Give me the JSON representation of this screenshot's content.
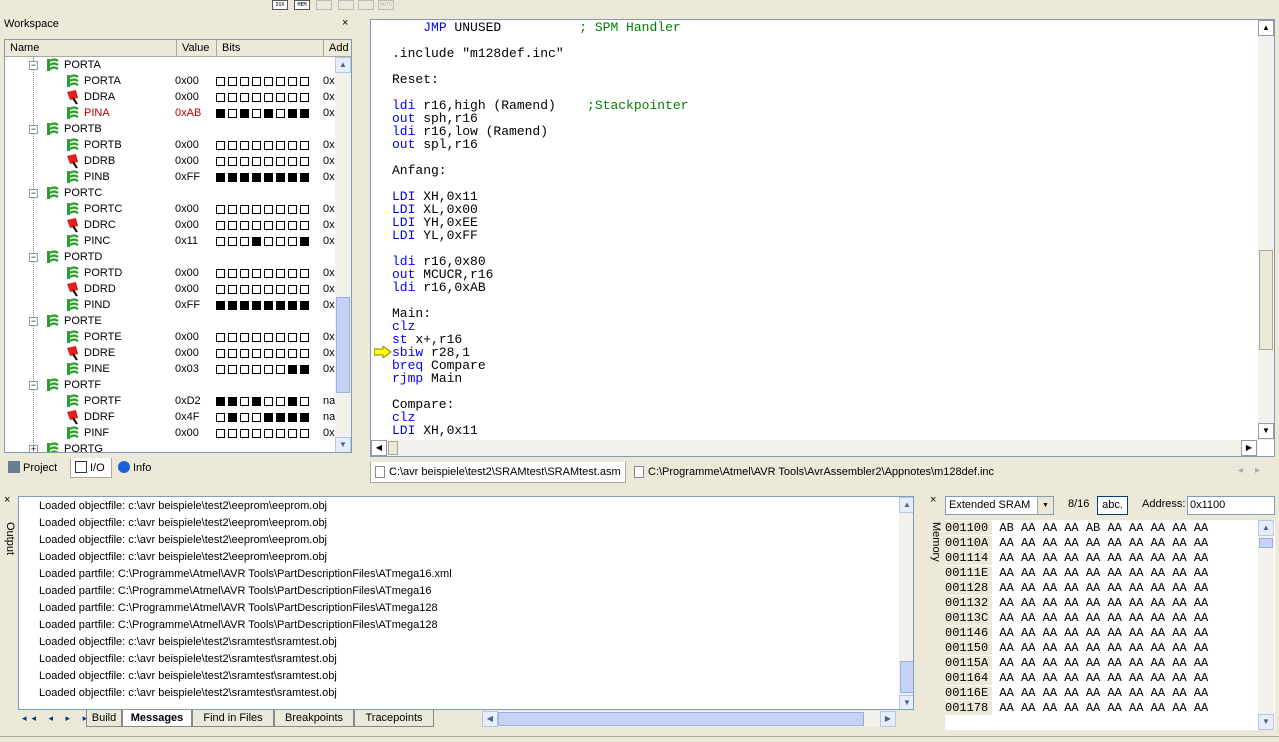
{
  "toolbar": {
    "icons": [
      {
        "name": "io-view-icon",
        "label": "IOX"
      },
      {
        "name": "mem-view-icon",
        "label": "MEM"
      },
      {
        "name": "processor-icon",
        "label": ""
      },
      {
        "name": "watch-icon",
        "label": ""
      },
      {
        "name": "disassembler-icon",
        "label": ""
      },
      {
        "name": "auto-icon",
        "label": "AUTO"
      }
    ]
  },
  "workspace": {
    "title": "Workspace",
    "close": "×",
    "columns": {
      "name": "Name",
      "value": "Value",
      "bits": "Bits",
      "addr": "Add"
    },
    "groups": [
      {
        "name": "PORTA",
        "regs": [
          {
            "name": "PORTA",
            "value": "0x00",
            "bits": [
              0,
              0,
              0,
              0,
              0,
              0,
              0,
              0
            ],
            "addr": "0x",
            "icon": "port",
            "red": false
          },
          {
            "name": "DDRA",
            "value": "0x00",
            "bits": [
              0,
              0,
              0,
              0,
              0,
              0,
              0,
              0
            ],
            "addr": "0x",
            "icon": "ddr",
            "red": false
          },
          {
            "name": "PINA",
            "value": "0xAB",
            "bits": [
              1,
              0,
              1,
              0,
              1,
              0,
              1,
              1
            ],
            "addr": "0x",
            "icon": "pin",
            "red": true
          }
        ]
      },
      {
        "name": "PORTB",
        "regs": [
          {
            "name": "PORTB",
            "value": "0x00",
            "bits": [
              0,
              0,
              0,
              0,
              0,
              0,
              0,
              0
            ],
            "addr": "0x",
            "icon": "port",
            "red": false
          },
          {
            "name": "DDRB",
            "value": "0x00",
            "bits": [
              0,
              0,
              0,
              0,
              0,
              0,
              0,
              0
            ],
            "addr": "0x",
            "icon": "ddr",
            "red": false
          },
          {
            "name": "PINB",
            "value": "0xFF",
            "bits": [
              1,
              1,
              1,
              1,
              1,
              1,
              1,
              1
            ],
            "addr": "0x",
            "icon": "pin",
            "red": false
          }
        ]
      },
      {
        "name": "PORTC",
        "regs": [
          {
            "name": "PORTC",
            "value": "0x00",
            "bits": [
              0,
              0,
              0,
              0,
              0,
              0,
              0,
              0
            ],
            "addr": "0x",
            "icon": "port",
            "red": false
          },
          {
            "name": "DDRC",
            "value": "0x00",
            "bits": [
              0,
              0,
              0,
              0,
              0,
              0,
              0,
              0
            ],
            "addr": "0x",
            "icon": "ddr",
            "red": false
          },
          {
            "name": "PINC",
            "value": "0x11",
            "bits": [
              0,
              0,
              0,
              1,
              0,
              0,
              0,
              1
            ],
            "addr": "0x",
            "icon": "pin",
            "red": false
          }
        ]
      },
      {
        "name": "PORTD",
        "regs": [
          {
            "name": "PORTD",
            "value": "0x00",
            "bits": [
              0,
              0,
              0,
              0,
              0,
              0,
              0,
              0
            ],
            "addr": "0x",
            "icon": "port",
            "red": false
          },
          {
            "name": "DDRD",
            "value": "0x00",
            "bits": [
              0,
              0,
              0,
              0,
              0,
              0,
              0,
              0
            ],
            "addr": "0x",
            "icon": "ddr",
            "red": false
          },
          {
            "name": "PIND",
            "value": "0xFF",
            "bits": [
              1,
              1,
              1,
              1,
              1,
              1,
              1,
              1
            ],
            "addr": "0x",
            "icon": "pin",
            "red": false
          }
        ]
      },
      {
        "name": "PORTE",
        "regs": [
          {
            "name": "PORTE",
            "value": "0x00",
            "bits": [
              0,
              0,
              0,
              0,
              0,
              0,
              0,
              0
            ],
            "addr": "0x",
            "icon": "port",
            "red": false
          },
          {
            "name": "DDRE",
            "value": "0x00",
            "bits": [
              0,
              0,
              0,
              0,
              0,
              0,
              0,
              0
            ],
            "addr": "0x",
            "icon": "ddr",
            "red": false
          },
          {
            "name": "PINE",
            "value": "0x03",
            "bits": [
              0,
              0,
              0,
              0,
              0,
              0,
              1,
              1
            ],
            "addr": "0x",
            "icon": "pin",
            "red": false
          }
        ]
      },
      {
        "name": "PORTF",
        "regs": [
          {
            "name": "PORTF",
            "value": "0xD2",
            "bits": [
              1,
              1,
              0,
              1,
              0,
              0,
              1,
              0
            ],
            "addr": "na",
            "icon": "port",
            "red": false
          },
          {
            "name": "DDRF",
            "value": "0x4F",
            "bits": [
              0,
              1,
              0,
              0,
              1,
              1,
              1,
              1
            ],
            "addr": "na",
            "icon": "ddr",
            "red": false
          },
          {
            "name": "PINF",
            "value": "0x00",
            "bits": [
              0,
              0,
              0,
              0,
              0,
              0,
              0,
              0
            ],
            "addr": "0x",
            "icon": "pin",
            "red": false
          }
        ]
      },
      {
        "name": "PORTG",
        "regs": []
      }
    ],
    "tabs": [
      {
        "label": "Project",
        "name": "tab-project"
      },
      {
        "label": "I/O",
        "name": "tab-io"
      },
      {
        "label": "Info",
        "name": "tab-info"
      }
    ]
  },
  "editor": {
    "lines": [
      [
        {
          "t": "    "
        },
        {
          "t": "JMP",
          "c": "kw"
        },
        {
          "t": " UNUSED          "
        },
        {
          "t": "; SPM Handler",
          "c": "cm"
        }
      ],
      [
        {
          "t": ""
        }
      ],
      [
        {
          "t": ".include \"m128def.inc\""
        }
      ],
      [
        {
          "t": ""
        }
      ],
      [
        {
          "t": "Reset:"
        }
      ],
      [
        {
          "t": ""
        }
      ],
      [
        {
          "t": "ldi",
          "c": "kw"
        },
        {
          "t": " r16,high (Ramend)    "
        },
        {
          "t": ";Stackpointer",
          "c": "cm"
        }
      ],
      [
        {
          "t": "out",
          "c": "kw"
        },
        {
          "t": " sph,r16"
        }
      ],
      [
        {
          "t": "ldi",
          "c": "kw"
        },
        {
          "t": " r16,low (Ramend)"
        }
      ],
      [
        {
          "t": "out",
          "c": "kw"
        },
        {
          "t": " spl,r16"
        }
      ],
      [
        {
          "t": ""
        }
      ],
      [
        {
          "t": "Anfang:"
        }
      ],
      [
        {
          "t": ""
        }
      ],
      [
        {
          "t": "LDI",
          "c": "kw"
        },
        {
          "t": " XH,0x11"
        }
      ],
      [
        {
          "t": "LDI",
          "c": "kw"
        },
        {
          "t": " XL,0x00"
        }
      ],
      [
        {
          "t": "LDI",
          "c": "kw"
        },
        {
          "t": " YH,0xEE"
        }
      ],
      [
        {
          "t": "LDI",
          "c": "kw"
        },
        {
          "t": " YL,0xFF"
        }
      ],
      [
        {
          "t": ""
        }
      ],
      [
        {
          "t": "ldi",
          "c": "kw"
        },
        {
          "t": " r16,0x80"
        }
      ],
      [
        {
          "t": "out",
          "c": "kw"
        },
        {
          "t": " MCUCR,r16"
        }
      ],
      [
        {
          "t": "ldi",
          "c": "kw"
        },
        {
          "t": " r16,0xAB"
        }
      ],
      [
        {
          "t": ""
        }
      ],
      [
        {
          "t": "Main:"
        }
      ],
      [
        {
          "t": "clz",
          "c": "kw"
        }
      ],
      [
        {
          "t": "st",
          "c": "kw"
        },
        {
          "t": " x+,r16"
        }
      ],
      [
        {
          "t": "sbiw",
          "c": "kw"
        },
        {
          "t": " r28,1"
        }
      ],
      [
        {
          "t": "breq",
          "c": "kw"
        },
        {
          "t": " Compare"
        }
      ],
      [
        {
          "t": "rjmp",
          "c": "kw"
        },
        {
          "t": " Main"
        }
      ],
      [
        {
          "t": ""
        }
      ],
      [
        {
          "t": "Compare:"
        }
      ],
      [
        {
          "t": "clz",
          "c": "kw"
        }
      ],
      [
        {
          "t": "LDI",
          "c": "kw"
        },
        {
          "t": " XH,0x11"
        }
      ]
    ],
    "tabs": [
      {
        "label": "C:\\avr beispiele\\test2\\SRAMtest\\SRAMtest.asm",
        "active": true
      },
      {
        "label": "C:\\Programme\\Atmel\\AVR Tools\\AvrAssembler2\\Appnotes\\m128def.inc",
        "active": false
      }
    ]
  },
  "output": {
    "side_label": "Output",
    "close": "×",
    "messages": [
      "Loaded objectfile: c:\\avr beispiele\\test2\\eeprom\\eeprom.obj",
      "Loaded objectfile: c:\\avr beispiele\\test2\\eeprom\\eeprom.obj",
      "Loaded objectfile: c:\\avr beispiele\\test2\\eeprom\\eeprom.obj",
      "Loaded objectfile: c:\\avr beispiele\\test2\\eeprom\\eeprom.obj",
      "Loaded partfile: C:\\Programme\\Atmel\\AVR Tools\\PartDescriptionFiles\\ATmega16.xml",
      "Loaded partfile: C:\\Programme\\Atmel\\AVR Tools\\PartDescriptionFiles\\ATmega16",
      "Loaded partfile: C:\\Programme\\Atmel\\AVR Tools\\PartDescriptionFiles\\ATmega128",
      "Loaded partfile: C:\\Programme\\Atmel\\AVR Tools\\PartDescriptionFiles\\ATmega128",
      "Loaded objectfile: c:\\avr beispiele\\test2\\sramtest\\sramtest.obj",
      "Loaded objectfile: c:\\avr beispiele\\test2\\sramtest\\sramtest.obj",
      "Loaded objectfile: c:\\avr beispiele\\test2\\sramtest\\sramtest.obj",
      "Loaded objectfile: c:\\avr beispiele\\test2\\sramtest\\sramtest.obj"
    ],
    "tabs": [
      {
        "label": "Build",
        "active": false
      },
      {
        "label": "Messages",
        "active": true
      },
      {
        "label": "Find in Files",
        "active": false
      },
      {
        "label": "Breakpoints",
        "active": false
      },
      {
        "label": "Tracepoints",
        "active": false
      }
    ],
    "nav": "◂◂ ◂ ▸ ▸▸"
  },
  "memory": {
    "side_label": "Memory",
    "close": "×",
    "type": "Extended SRAM",
    "width": "8/16",
    "abc": "abc.",
    "address_label": "Address:",
    "address": "0x1100",
    "rows": [
      {
        "addr": "001100",
        "bytes": "AB AA AA AA AB AA AA AA AA AA"
      },
      {
        "addr": "00110A",
        "bytes": "AA AA AA AA AA AA AA AA AA AA"
      },
      {
        "addr": "001114",
        "bytes": "AA AA AA AA AA AA AA AA AA AA"
      },
      {
        "addr": "00111E",
        "bytes": "AA AA AA AA AA AA AA AA AA AA"
      },
      {
        "addr": "001128",
        "bytes": "AA AA AA AA AA AA AA AA AA AA"
      },
      {
        "addr": "001132",
        "bytes": "AA AA AA AA AA AA AA AA AA AA"
      },
      {
        "addr": "00113C",
        "bytes": "AA AA AA AA AA AA AA AA AA AA"
      },
      {
        "addr": "001146",
        "bytes": "AA AA AA AA AA AA AA AA AA AA"
      },
      {
        "addr": "001150",
        "bytes": "AA AA AA AA AA AA AA AA AA AA"
      },
      {
        "addr": "00115A",
        "bytes": "AA AA AA AA AA AA AA AA AA AA"
      },
      {
        "addr": "001164",
        "bytes": "AA AA AA AA AA AA AA AA AA AA"
      },
      {
        "addr": "00116E",
        "bytes": "AA AA AA AA AA AA AA AA AA AA"
      },
      {
        "addr": "001178",
        "bytes": "AA AA AA AA AA AA AA AA AA AA"
      }
    ]
  }
}
